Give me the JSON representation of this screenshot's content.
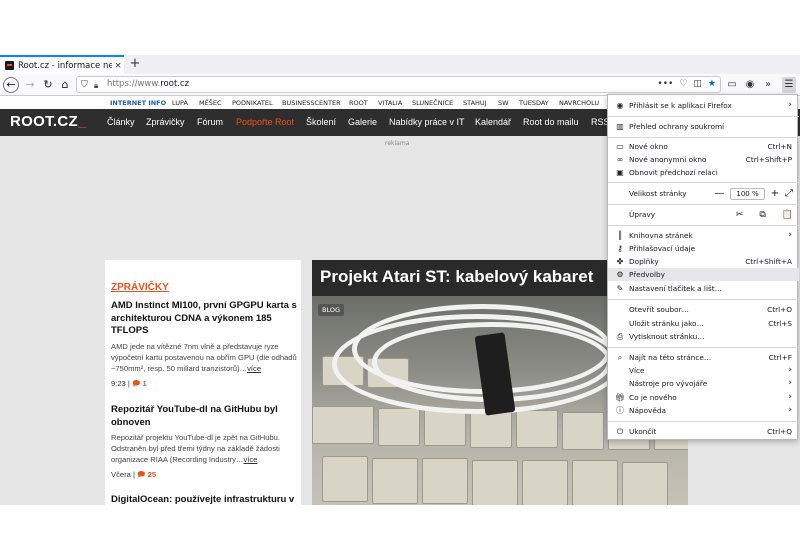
{
  "browser": {
    "tab_title": "Root.cz - informace nejen ze světa Linuxu",
    "tab_close": "×",
    "new_tab": "+",
    "url_host": "https://www.",
    "url_domain": "root.cz",
    "url_icons": [
      "•••",
      "♡",
      "◫",
      "★"
    ],
    "toolbar_icons": [
      "▭",
      "◉",
      "»",
      "☰"
    ]
  },
  "site": {
    "topnav": [
      "INTERNET INFO",
      "LUPA",
      "MĚŠEC",
      "PODNIKATEL",
      "BUSINESSCENTER",
      "ROOT",
      "VITALIA",
      "SLUNEČNICE",
      "STAHUJ",
      "SW",
      "TUESDAY",
      "NAVRCHOLU"
    ],
    "logo": "ROOT.CZ",
    "logo_suffix": "_",
    "menu": [
      "Články",
      "Zprávičky",
      "Fórum",
      "Podpořte Root",
      "Školení",
      "Galerie",
      "Nabídky práce v IT",
      "Kalendář",
      "Root do mailu",
      "RSS"
    ],
    "ad_label": "reklama",
    "news_section": "ZPRÁVIČKY",
    "articles": [
      {
        "title": "AMD Instinct MI100, první GPGPU karta s architekturou CDNA a výkonem 185 TFLOPS",
        "perex": "AMD jede na vítězné 7nm vlně a představuje ryze výpočetní kartu postavenou na obřím GPU (dle odhadů ~750mm², resp. 50 miliard tranzistorů)…",
        "more": "více",
        "time": "9:23",
        "comments": "1"
      },
      {
        "title": "Repozitář YouTube-dl na GitHubu byl obnoven",
        "perex": "Repozitář projektu YouTube-dl je zpět na GitHubu. Odstraněn byl před třemi týdny na základě žádosti organizace RIAA (Recording Industry…",
        "more": "více",
        "time": "Včera",
        "comments": "25"
      },
      {
        "title": "DigitalOcean: používejte infrastrukturu v"
      }
    ],
    "featured": {
      "title": "Projekt Atari ST: kabelový kabaret",
      "badge": "BLOG"
    }
  },
  "ff_menu": {
    "signin": "Přihlásit se k aplikaci Firefox",
    "privacy": "Přehled ochrany soukromí",
    "new_window": {
      "label": "Nové okno",
      "shortcut": "Ctrl+N"
    },
    "private_window": {
      "label": "Nové anonymní okno",
      "shortcut": "Ctrl+Shift+P"
    },
    "restore": "Obnovit předchozí relaci",
    "zoom": {
      "label": "Velikost stránky",
      "minus": "—",
      "value": "100 %",
      "plus": "+",
      "full": "⤢"
    },
    "edit": {
      "label": "Úpravy",
      "cut": "✂",
      "copy": "⧉",
      "paste": "📋"
    },
    "library": "Knihovna stránek",
    "logins": "Přihlašovací údaje",
    "addons": {
      "label": "Doplňky",
      "shortcut": "Ctrl+Shift+A"
    },
    "prefs": "Předvolby",
    "customize": "Nastavení tlačítek a lišt…",
    "open_file": {
      "label": "Otevřít soubor…",
      "shortcut": "Ctrl+O"
    },
    "save_page": {
      "label": "Uložit stránku jako…",
      "shortcut": "Ctrl+S"
    },
    "print": "Vytisknout stránku…",
    "find": {
      "label": "Najít na této stránce…",
      "shortcut": "Ctrl+F"
    },
    "more": "Více",
    "devtools": "Nástroje pro vývojáře",
    "whatsnew": "Co je nového",
    "help": "Nápověda",
    "quit": {
      "label": "Ukončit",
      "shortcut": "Ctrl+Q"
    }
  }
}
